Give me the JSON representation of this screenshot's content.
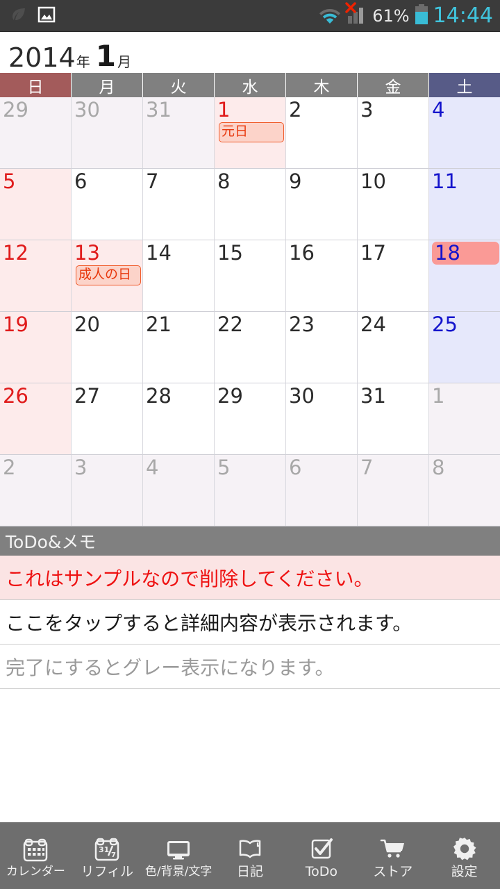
{
  "status_bar": {
    "left_icons": [
      "leaf-icon",
      "image-icon"
    ],
    "wifi_icon": "wifi-icon",
    "signal_icon": "signal-bars-icon",
    "signal_error_icon": "red-x-icon",
    "battery_percent": "61%",
    "battery_icon": "battery-icon",
    "clock": "14:44",
    "colors": {
      "accent": "#40c4dd",
      "background": "#3b3b3b",
      "error": "#ee2200"
    }
  },
  "header": {
    "year": "2014",
    "year_label": "年",
    "month": "1",
    "month_label": "月"
  },
  "calendar": {
    "weekdays": [
      {
        "label": "日",
        "type": "sun"
      },
      {
        "label": "月",
        "type": "wk"
      },
      {
        "label": "火",
        "type": "wk"
      },
      {
        "label": "水",
        "type": "wk"
      },
      {
        "label": "木",
        "type": "wk"
      },
      {
        "label": "金",
        "type": "wk"
      },
      {
        "label": "土",
        "type": "sat"
      }
    ],
    "weeks": [
      [
        {
          "num": "29",
          "state": "out sun"
        },
        {
          "num": "30",
          "state": "out"
        },
        {
          "num": "31",
          "state": "out"
        },
        {
          "num": "1",
          "state": "holiday",
          "event": "元日"
        },
        {
          "num": "2",
          "state": ""
        },
        {
          "num": "3",
          "state": ""
        },
        {
          "num": "4",
          "state": "sat"
        }
      ],
      [
        {
          "num": "5",
          "state": "sun"
        },
        {
          "num": "6",
          "state": ""
        },
        {
          "num": "7",
          "state": ""
        },
        {
          "num": "8",
          "state": ""
        },
        {
          "num": "9",
          "state": ""
        },
        {
          "num": "10",
          "state": ""
        },
        {
          "num": "11",
          "state": "sat"
        }
      ],
      [
        {
          "num": "12",
          "state": "sun"
        },
        {
          "num": "13",
          "state": "holiday",
          "event": "成人の日"
        },
        {
          "num": "14",
          "state": ""
        },
        {
          "num": "15",
          "state": ""
        },
        {
          "num": "16",
          "state": ""
        },
        {
          "num": "17",
          "state": ""
        },
        {
          "num": "18",
          "state": "sat",
          "today": true
        }
      ],
      [
        {
          "num": "19",
          "state": "sun"
        },
        {
          "num": "20",
          "state": ""
        },
        {
          "num": "21",
          "state": ""
        },
        {
          "num": "22",
          "state": ""
        },
        {
          "num": "23",
          "state": ""
        },
        {
          "num": "24",
          "state": ""
        },
        {
          "num": "25",
          "state": "sat"
        }
      ],
      [
        {
          "num": "26",
          "state": "sun"
        },
        {
          "num": "27",
          "state": ""
        },
        {
          "num": "28",
          "state": ""
        },
        {
          "num": "29",
          "state": ""
        },
        {
          "num": "30",
          "state": ""
        },
        {
          "num": "31",
          "state": ""
        },
        {
          "num": "1",
          "state": "out sat"
        }
      ],
      [
        {
          "num": "2",
          "state": "out sun"
        },
        {
          "num": "3",
          "state": "out"
        },
        {
          "num": "4",
          "state": "out"
        },
        {
          "num": "5",
          "state": "out"
        },
        {
          "num": "6",
          "state": "out"
        },
        {
          "num": "7",
          "state": "out"
        },
        {
          "num": "8",
          "state": "out sat"
        }
      ]
    ],
    "colors": {
      "sunday_header": "#a35b5b",
      "saturday_header": "#575b87",
      "weekday_header": "#808080",
      "sunday_cell": "#fdebeb",
      "saturday_cell": "#e6e8fb",
      "outside_cell": "#f6f2f6",
      "today_highlight": "#fa9a96",
      "event_border": "#f05a28"
    }
  },
  "todo": {
    "section_title": "ToDo&メモ",
    "items": [
      {
        "text": "これはサンプルなので削除してください。",
        "style": "alert"
      },
      {
        "text": "ここをタップすると詳細内容が表示されます。",
        "style": "normal"
      },
      {
        "text": "完了にするとグレー表示になります。",
        "style": "done"
      }
    ]
  },
  "navbar": {
    "items": [
      {
        "label": "カレンダー",
        "icon": "calendar-icon",
        "small": true
      },
      {
        "label": "リフィル",
        "icon": "refill-calendar-icon",
        "small": false
      },
      {
        "label": "色/背景/文字",
        "icon": "monitor-icon",
        "small": true
      },
      {
        "label": "日記",
        "icon": "book-icon",
        "small": false
      },
      {
        "label": "ToDo",
        "icon": "checkbox-icon",
        "small": false
      },
      {
        "label": "ストア",
        "icon": "shopping-cart-icon",
        "small": false
      },
      {
        "label": "設定",
        "icon": "gear-icon",
        "small": false
      }
    ]
  }
}
